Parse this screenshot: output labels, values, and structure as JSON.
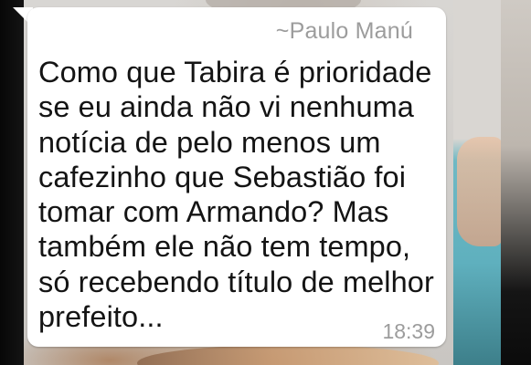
{
  "message": {
    "sender": "~Paulo Manú",
    "lines": [
      "Como que Tabira é prioridade",
      "se eu ainda não vi nenhuma",
      "notícia de pelo menos um",
      "cafezinho que Sebastião foi",
      "tomar com Armando? Mas",
      "também ele não tem tempo,",
      "só recebendo título de melhor",
      "prefeito..."
    ],
    "time": "18:39"
  },
  "colors": {
    "bubble": "#ffffff",
    "text": "#141414",
    "meta_text": "#9c9c9c"
  }
}
